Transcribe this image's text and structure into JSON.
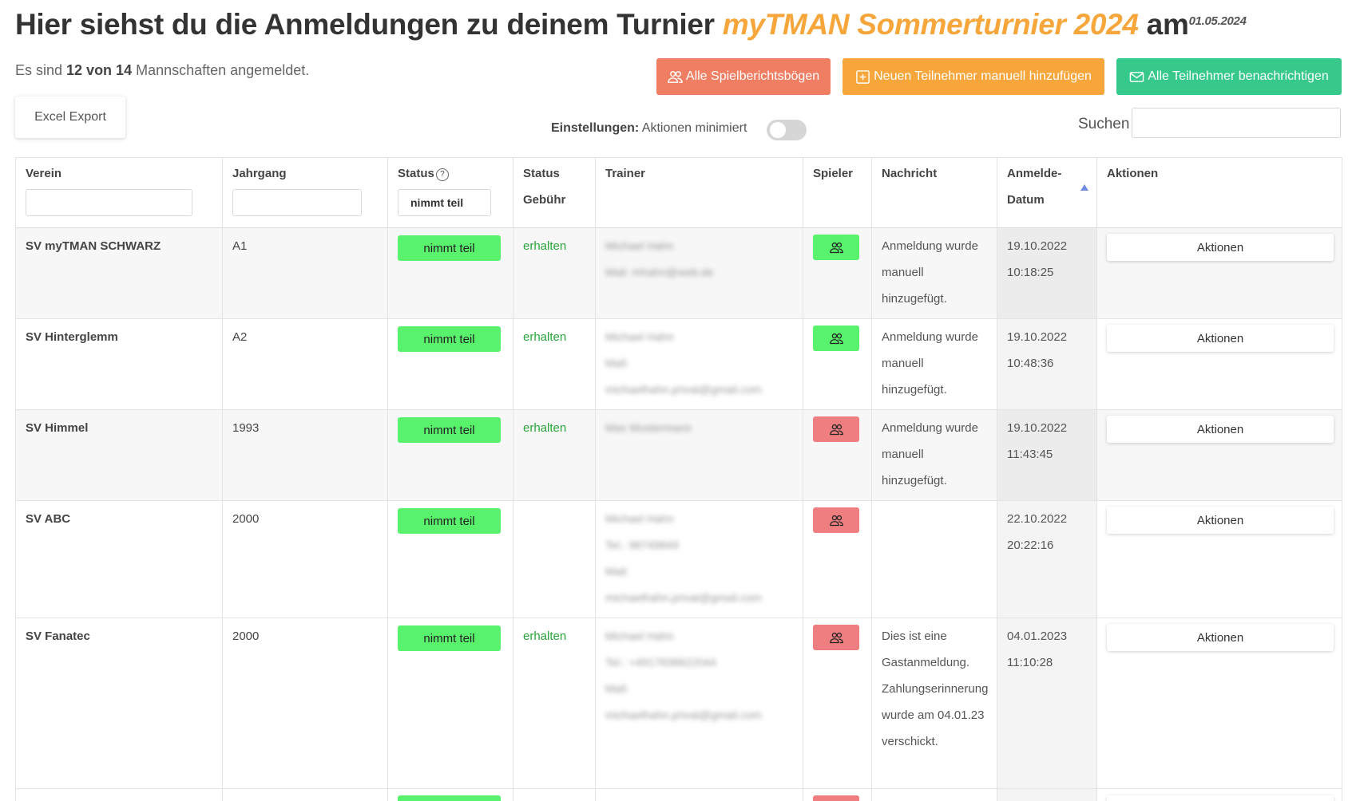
{
  "header": {
    "title_prefix": "Hier siehst du die Anmeldungen zu deinem Turnier ",
    "tournament": "myTMAN Sommerturnier 2024",
    "title_mid": " am ",
    "date": "01.05.2024"
  },
  "registration_count": {
    "prefix": "Es sind ",
    "count": "12 von 14",
    "suffix": " Mannschaften angemeldet."
  },
  "buttons": {
    "reports": "Alle Spielberichtsbögen",
    "add_participant": "Neuen Teilnehmer manuell hinzufügen",
    "notify_all": "Alle Teilnehmer benachrichtigen",
    "excel_export": "Excel Export"
  },
  "settings": {
    "label": "Einstellungen:",
    "value": "Aktionen minimiert",
    "toggle_on": false
  },
  "search": {
    "label": "Suchen",
    "value": ""
  },
  "colors": {
    "red": "#ef7e63",
    "orange": "#f6a63a",
    "green": "#36c98b",
    "pill_green": "#59f26c",
    "pill_red": "#ef7e80"
  },
  "table": {
    "columns": {
      "verein": "Verein",
      "jahrgang": "Jahrgang",
      "status": "Status",
      "status_fee_1": "Status",
      "status_fee_2": "Gebühr",
      "trainer": "Trainer",
      "spieler": "Spieler",
      "nachricht": "Nachricht",
      "date_1": "Anmelde-",
      "date_2": "Datum",
      "aktionen": "Aktionen"
    },
    "status_filter": "nimmt teil",
    "rows": [
      {
        "verein": "SV myTMAN SCHWARZ",
        "jahrgang": "A1",
        "status": "nimmt teil",
        "fee": "erhalten",
        "trainer": [
          "Michael Hahn",
          "Mail: mhahn@web.de"
        ],
        "players_state": "green",
        "message": "Anmeldung wurde manuell hinzugefügt.",
        "date": "19.10.2022",
        "time": "10:18:25",
        "action": "Aktionen"
      },
      {
        "verein": "SV Hinterglemm",
        "jahrgang": "A2",
        "status": "nimmt teil",
        "fee": "erhalten",
        "trainer": [
          "Michael Hahn",
          "Mail:",
          "michaelhahn.privat@gmail.com"
        ],
        "players_state": "green",
        "message": "Anmeldung wurde manuell hinzugefügt.",
        "date": "19.10.2022",
        "time": "10:48:36",
        "action": "Aktionen"
      },
      {
        "verein": "SV Himmel",
        "jahrgang": "1993",
        "status": "nimmt teil",
        "fee": "erhalten",
        "trainer": [
          "Max Mustermann"
        ],
        "players_state": "red",
        "message": "Anmeldung wurde manuell hinzugefügt.",
        "date": "19.10.2022",
        "time": "11:43:45",
        "action": "Aktionen"
      },
      {
        "verein": "SV ABC",
        "jahrgang": "2000",
        "status": "nimmt teil",
        "fee": "",
        "trainer": [
          "Michael Hahn",
          "Tel.: 98749849",
          "Mail:",
          "michaelhahn.privat@gmail.com"
        ],
        "players_state": "red",
        "message": "",
        "date": "22.10.2022",
        "time": "20:22:16",
        "action": "Aktionen"
      },
      {
        "verein": "SV Fanatec",
        "jahrgang": "2000",
        "status": "nimmt teil",
        "fee": "erhalten",
        "trainer": [
          "Michael Hahn",
          "Tel.: +4917838622044",
          "Mail:",
          "michaelhahn.privat@gmail.com"
        ],
        "players_state": "red",
        "message": "Dies ist eine Gastanmeldung. Zahlungserinnerung wurde am 04.01.23 verschickt.",
        "date": "04.01.2023",
        "time": "11:10:28",
        "action": "Aktionen"
      }
    ]
  }
}
